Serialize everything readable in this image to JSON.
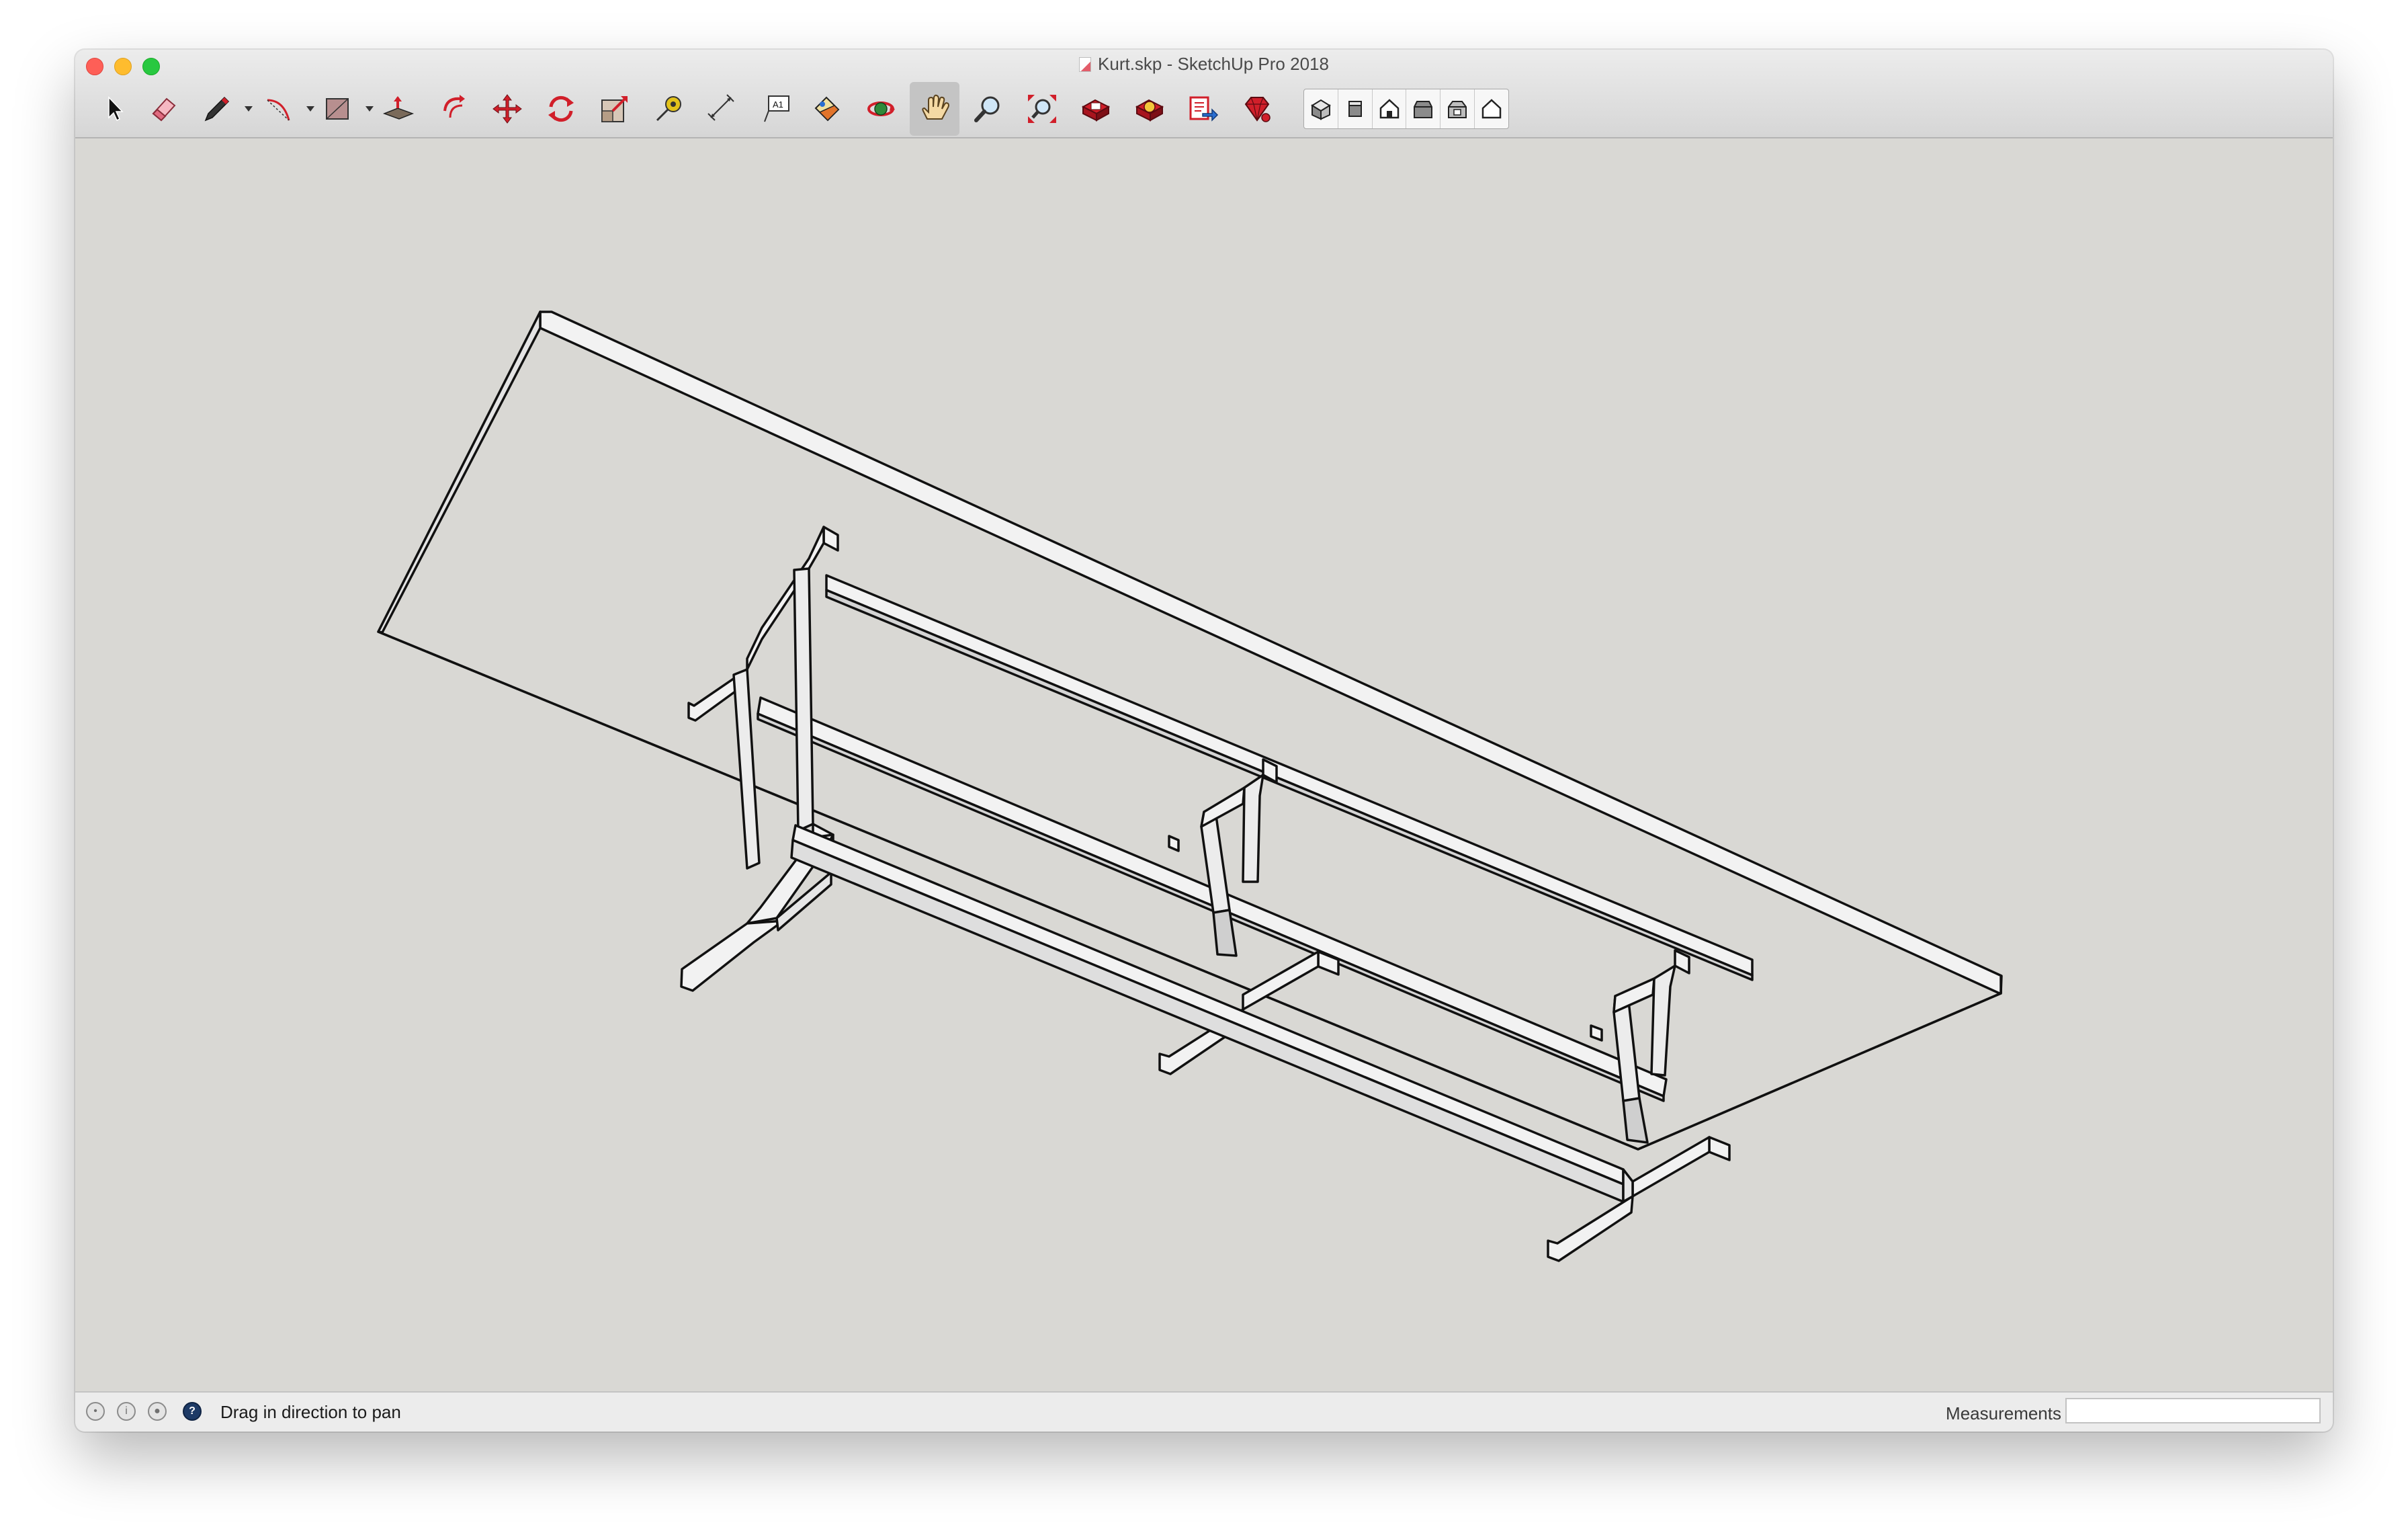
{
  "window": {
    "title": "Kurt.skp - SketchUp Pro 2018"
  },
  "toolbar": {
    "tools": [
      {
        "id": "select",
        "icon": "arrow-cursor-icon"
      },
      {
        "id": "eraser",
        "icon": "eraser-icon"
      },
      {
        "id": "line",
        "icon": "pencil-icon",
        "has_dropdown": true
      },
      {
        "id": "arc",
        "icon": "arc-icon",
        "has_dropdown": true
      },
      {
        "id": "shapes",
        "icon": "rectangle-icon",
        "has_dropdown": true
      },
      {
        "id": "push-pull",
        "icon": "push-pull-icon"
      },
      {
        "id": "offset",
        "icon": "offset-icon"
      },
      {
        "id": "move",
        "icon": "move-icon"
      },
      {
        "id": "rotate",
        "icon": "rotate-icon"
      },
      {
        "id": "scale",
        "icon": "scale-icon"
      },
      {
        "id": "tape-measure",
        "icon": "tape-measure-icon"
      },
      {
        "id": "dimension",
        "icon": "dimension-icon"
      },
      {
        "id": "text",
        "icon": "text-icon",
        "glyph": "A1"
      },
      {
        "id": "paint-bucket",
        "icon": "paint-bucket-icon"
      },
      {
        "id": "orbit",
        "icon": "orbit-icon"
      },
      {
        "id": "pan",
        "icon": "hand-pan-icon",
        "active": true
      },
      {
        "id": "zoom",
        "icon": "magnifier-icon"
      },
      {
        "id": "zoom-extents",
        "icon": "zoom-extents-icon"
      },
      {
        "id": "warehouse",
        "icon": "3d-warehouse-icon"
      },
      {
        "id": "extension-warehouse",
        "icon": "extension-warehouse-icon"
      },
      {
        "id": "layout",
        "icon": "send-to-layout-icon"
      },
      {
        "id": "extension-manager",
        "icon": "ruby-gem-icon"
      }
    ],
    "views": [
      {
        "id": "iso",
        "icon": "iso-view-icon"
      },
      {
        "id": "top",
        "icon": "top-view-icon"
      },
      {
        "id": "front",
        "icon": "front-view-icon"
      },
      {
        "id": "right",
        "icon": "right-view-icon"
      },
      {
        "id": "back",
        "icon": "back-view-icon"
      },
      {
        "id": "left",
        "icon": "left-view-icon"
      }
    ]
  },
  "status": {
    "message": "Drag in direction to pan",
    "measurements_label": "Measurements",
    "measurements_value": ""
  },
  "colors": {
    "viewport_bg": "#d9d8d4",
    "model_face": "#f2f2f2",
    "model_shade": "#c9c9c9",
    "edge": "#111111",
    "tool_red": "#d11f2a",
    "active_tool_bg": "#c4c4c4"
  }
}
